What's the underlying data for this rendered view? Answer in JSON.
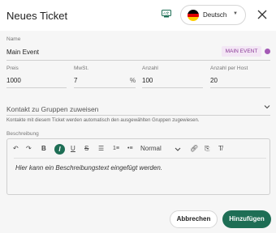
{
  "header": {
    "title": "Neues Ticket",
    "language": {
      "label": "Deutsch",
      "flag_colors": [
        "#000000",
        "#dd0000",
        "#ffce00"
      ]
    }
  },
  "form": {
    "name": {
      "label": "Name",
      "value": "Main Event",
      "tag": "MAIN EVENT",
      "tag_color": "#a45ab5"
    },
    "price": {
      "label": "Preis",
      "value": "1000"
    },
    "vat": {
      "label": "MwSt.",
      "value": "7",
      "unit": "%"
    },
    "quantity": {
      "label": "Anzahl",
      "value": "100"
    },
    "per_host": {
      "label": "Anzahl per Host",
      "value": "20"
    },
    "groups": {
      "label": "Kontakt zu Gruppen zuweisen",
      "hint": "Kontakte mit diesem Ticket werden automatisch den ausgewählten Gruppen zugewiesen."
    },
    "description": {
      "label": "Beschreibung",
      "format": "Normal",
      "placeholder": "Hier kann ein Beschreibungstext eingefügt werden."
    }
  },
  "actions": {
    "cancel": "Abbrechen",
    "submit": "Hinzufügen"
  },
  "colors": {
    "accent": "#1e6e55",
    "tag_bg": "#f3e6f5"
  }
}
